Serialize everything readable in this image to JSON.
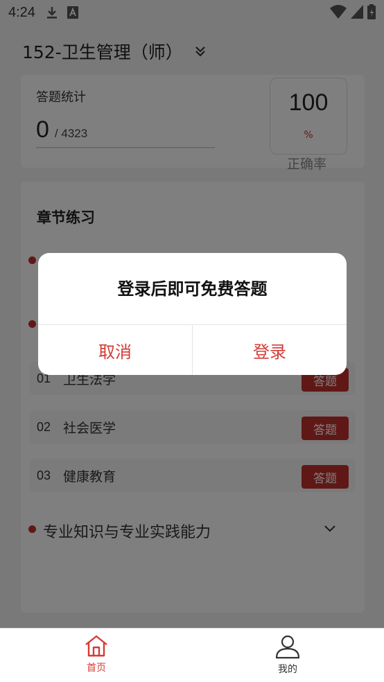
{
  "status_bar": {
    "time": "4:24",
    "icons": [
      "download-icon",
      "font-icon",
      "wifi-icon",
      "signal-icon",
      "battery-icon"
    ]
  },
  "header": {
    "title": "152-卫生管理（师）",
    "icon": "double-chevron-down-icon"
  },
  "stats": {
    "label": "答题统计",
    "done": "0",
    "total": "/ 4323",
    "rate_value": "100",
    "rate_unit": "%",
    "rate_label": "正确率"
  },
  "chapters": {
    "title": "章节练习",
    "items": [
      {
        "num": "01",
        "name": "卫生法学",
        "button": "答题"
      },
      {
        "num": "02",
        "name": "社会医学",
        "button": "答题"
      },
      {
        "num": "03",
        "name": "健康教育",
        "button": "答题"
      }
    ],
    "section_title": "专业知识与专业实践能力",
    "section_icon": "chevron-down-icon"
  },
  "bottom_nav": {
    "items": [
      {
        "label": "首页",
        "icon": "home-icon",
        "active": true
      },
      {
        "label": "我的",
        "icon": "user-icon",
        "active": false
      }
    ]
  },
  "dialog": {
    "message": "登录后即可免费答题",
    "cancel_label": "取消",
    "login_label": "登录"
  },
  "colors": {
    "accent": "#c0302c",
    "dialog_button": "#d63a34",
    "overlay": "rgba(0,0,0,0.5)"
  }
}
